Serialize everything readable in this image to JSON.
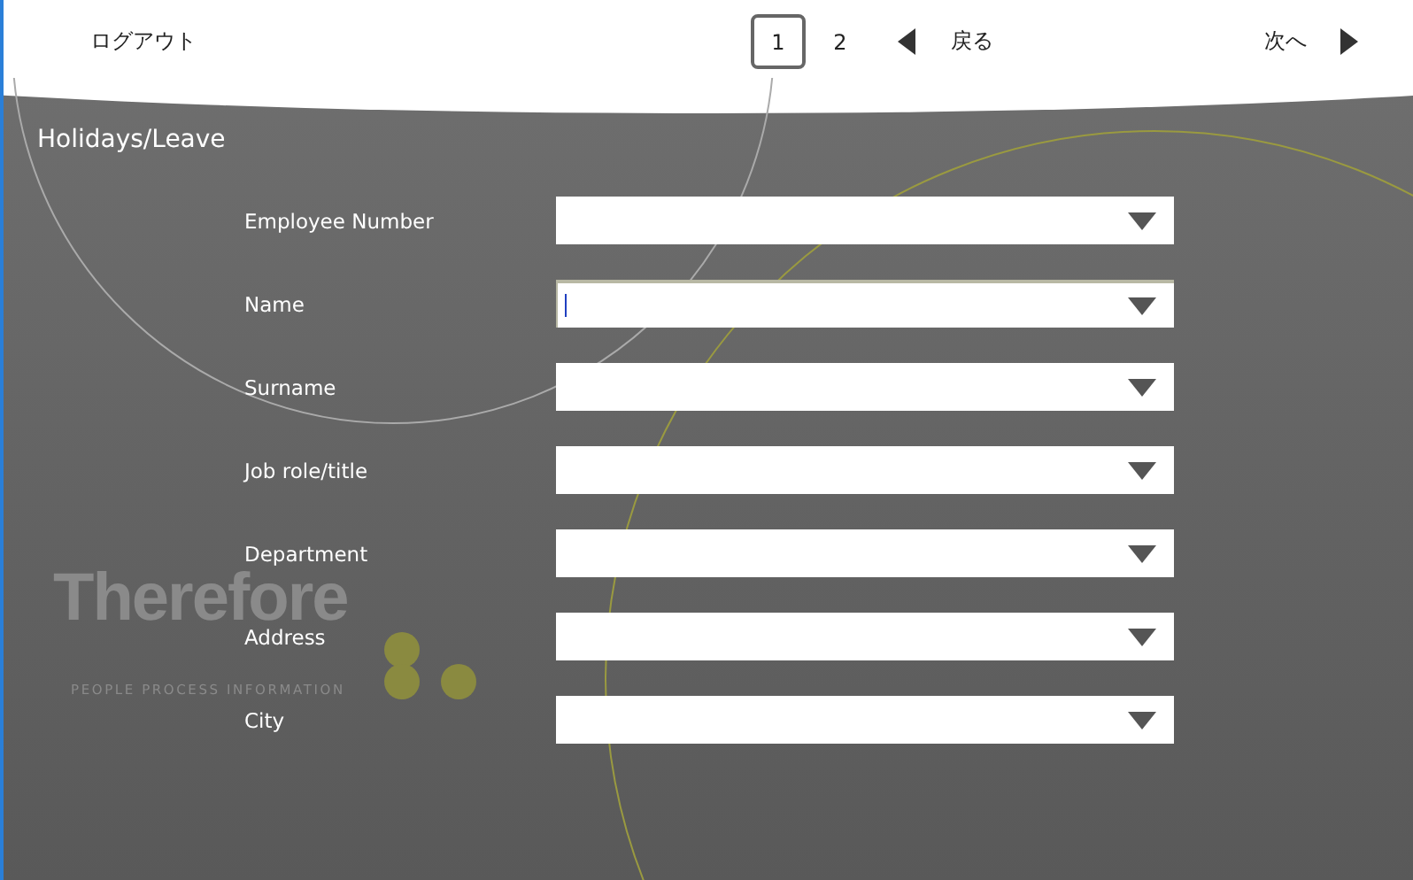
{
  "header": {
    "logout": "ログアウト",
    "pages": [
      {
        "label": "1",
        "selected": true
      },
      {
        "label": "2",
        "selected": false
      }
    ],
    "back": "戻る",
    "next": "次へ"
  },
  "title": "Holidays/Leave",
  "fields": [
    {
      "label": "Employee Number",
      "focused": false
    },
    {
      "label": "Name",
      "focused": true
    },
    {
      "label": "Surname",
      "focused": false
    },
    {
      "label": "Job role/title",
      "focused": false
    },
    {
      "label": "Department",
      "focused": false
    },
    {
      "label": "Address",
      "focused": false
    },
    {
      "label": "City",
      "focused": false
    }
  ],
  "background_logo": {
    "name": "Therefore",
    "tagline": "PEOPLE PROCESS INFORMATION"
  }
}
